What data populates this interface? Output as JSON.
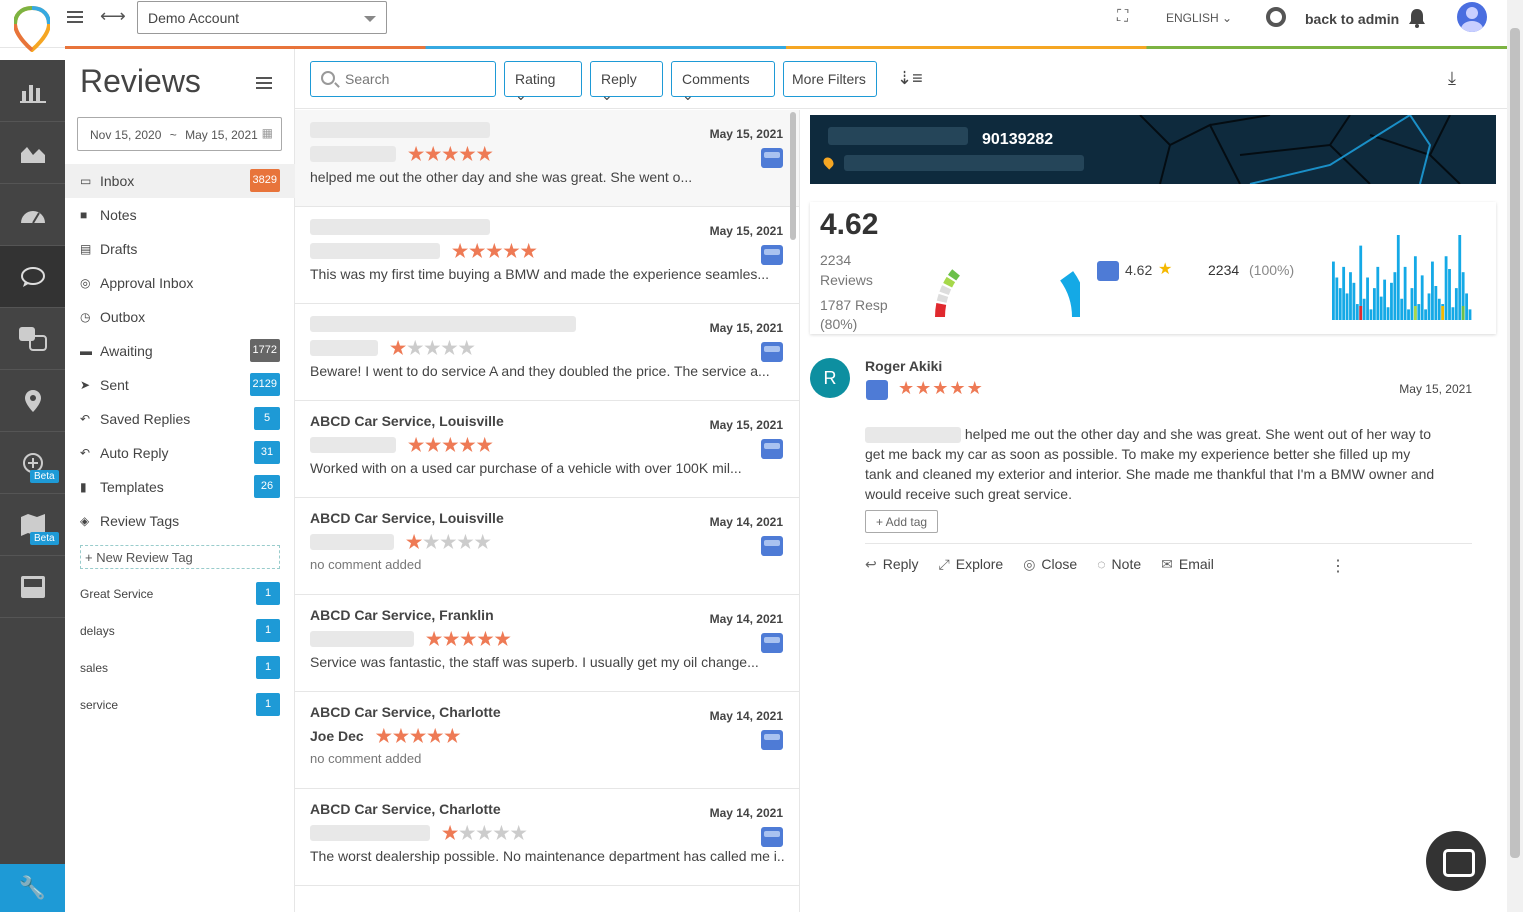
{
  "header": {
    "account": "Demo Account",
    "language": "ENGLISH",
    "admin_link": "back to admin"
  },
  "rail": {
    "items": [
      "analytics-icon",
      "area-chart-icon",
      "dashboard-icon",
      "reviews-icon",
      "qa-icon",
      "location-icon",
      "listing-icon",
      "maps-icon",
      "inbox-icon"
    ],
    "beta_label": "Beta"
  },
  "left": {
    "title": "Reviews",
    "date_from": "Nov 15, 2020",
    "date_sep": "~",
    "date_to": "May 15, 2021",
    "nav": [
      {
        "label": "Inbox",
        "badge": "3829",
        "badge_color": "#e8743b"
      },
      {
        "label": "Notes",
        "badge": ""
      },
      {
        "label": "Drafts",
        "badge": ""
      },
      {
        "label": "Approval Inbox",
        "badge": ""
      },
      {
        "label": "Outbox",
        "badge": ""
      },
      {
        "label": "Awaiting",
        "badge": "1772",
        "badge_color": "#666666"
      },
      {
        "label": "Sent",
        "badge": "2129",
        "badge_color": "#1e9ad6"
      },
      {
        "label": "Saved Replies",
        "badge": "5",
        "badge_color": "#1e9ad6"
      },
      {
        "label": "Auto Reply",
        "badge": "31",
        "badge_color": "#1e9ad6"
      },
      {
        "label": "Templates",
        "badge": "26",
        "badge_color": "#1e9ad6"
      },
      {
        "label": "Review Tags",
        "badge": ""
      }
    ],
    "new_tag": "+ New Review Tag",
    "tags": [
      {
        "label": "Great Service",
        "count": "1"
      },
      {
        "label": "delays",
        "count": "1"
      },
      {
        "label": "sales",
        "count": "1"
      },
      {
        "label": "service",
        "count": "1"
      }
    ]
  },
  "toolbar": {
    "search_placeholder": "Search",
    "rating": "Rating",
    "reply": "Reply",
    "comments": "Comments",
    "more_filters": "More Filters"
  },
  "reviews": [
    {
      "location": "",
      "name": "",
      "date": "May 15, 2021",
      "rating": 5,
      "text": "helped me out the other day and she was great. She went o..."
    },
    {
      "location": "",
      "name": "",
      "date": "May 15, 2021",
      "rating": 5,
      "text": "This was my first time buying a BMW and       made the experience seamles..."
    },
    {
      "location": "",
      "name": "",
      "date": "May 15, 2021",
      "rating": 1,
      "text": "Beware! I went to do service A and they doubled the price. The service a..."
    },
    {
      "location": "ABCD Car Service, Louisville",
      "name": "",
      "date": "May 15, 2021",
      "rating": 5,
      "text": "Worked with        on a used car purchase of a vehicle with over 100K mil..."
    },
    {
      "location": "ABCD Car Service, Louisville",
      "name": "",
      "date": "May 14, 2021",
      "rating": 1,
      "text": "no comment added"
    },
    {
      "location": "ABCD Car Service, Franklin",
      "name": "",
      "date": "May 14, 2021",
      "rating": 5,
      "text": "Service was fantastic, the staff was superb. I usually get my oil change..."
    },
    {
      "location": "ABCD Car Service, Charlotte",
      "name": "Joe Dec",
      "date": "May 14, 2021",
      "rating": 5,
      "text": "no comment added"
    },
    {
      "location": "ABCD Car Service, Charlotte",
      "name": "",
      "date": "May 14, 2021",
      "rating": 1,
      "text": "The worst dealership possible. No maintenance department has called me i..."
    }
  ],
  "detail": {
    "banner_number": "90139282",
    "avg_rating": "4.62",
    "reviews_count": "2234",
    "reviews_label": "Reviews",
    "resp_count": "1787 Resp",
    "resp_pct": "(80%)",
    "google_rating": "4.62",
    "google_count": "2234",
    "google_pct": "(100%)",
    "gauge_fraction": 0.8,
    "histogram": [
      55,
      40,
      30,
      50,
      25,
      45,
      35,
      15,
      70,
      20,
      40,
      10,
      30,
      50,
      22,
      38,
      12,
      35,
      45,
      80,
      20,
      50,
      10,
      30,
      60,
      15,
      42,
      10,
      25,
      55,
      32,
      20,
      15,
      60,
      48,
      12,
      30,
      80,
      45,
      25,
      10
    ],
    "review": {
      "initial": "R",
      "name": "Roger Akiki",
      "date": "May 15, 2021",
      "rating": 5,
      "body": "helped me out the other day and she was great. She went out of her way to get me back my car as soon as possible. To make my experience better she filled up my tank and cleaned my exterior and interior. She made me thankful that I'm a BMW owner and would receive such great service.",
      "add_tag": "+ Add tag",
      "actions": [
        "Reply",
        "Explore",
        "Close",
        "Note",
        "Email"
      ]
    }
  }
}
